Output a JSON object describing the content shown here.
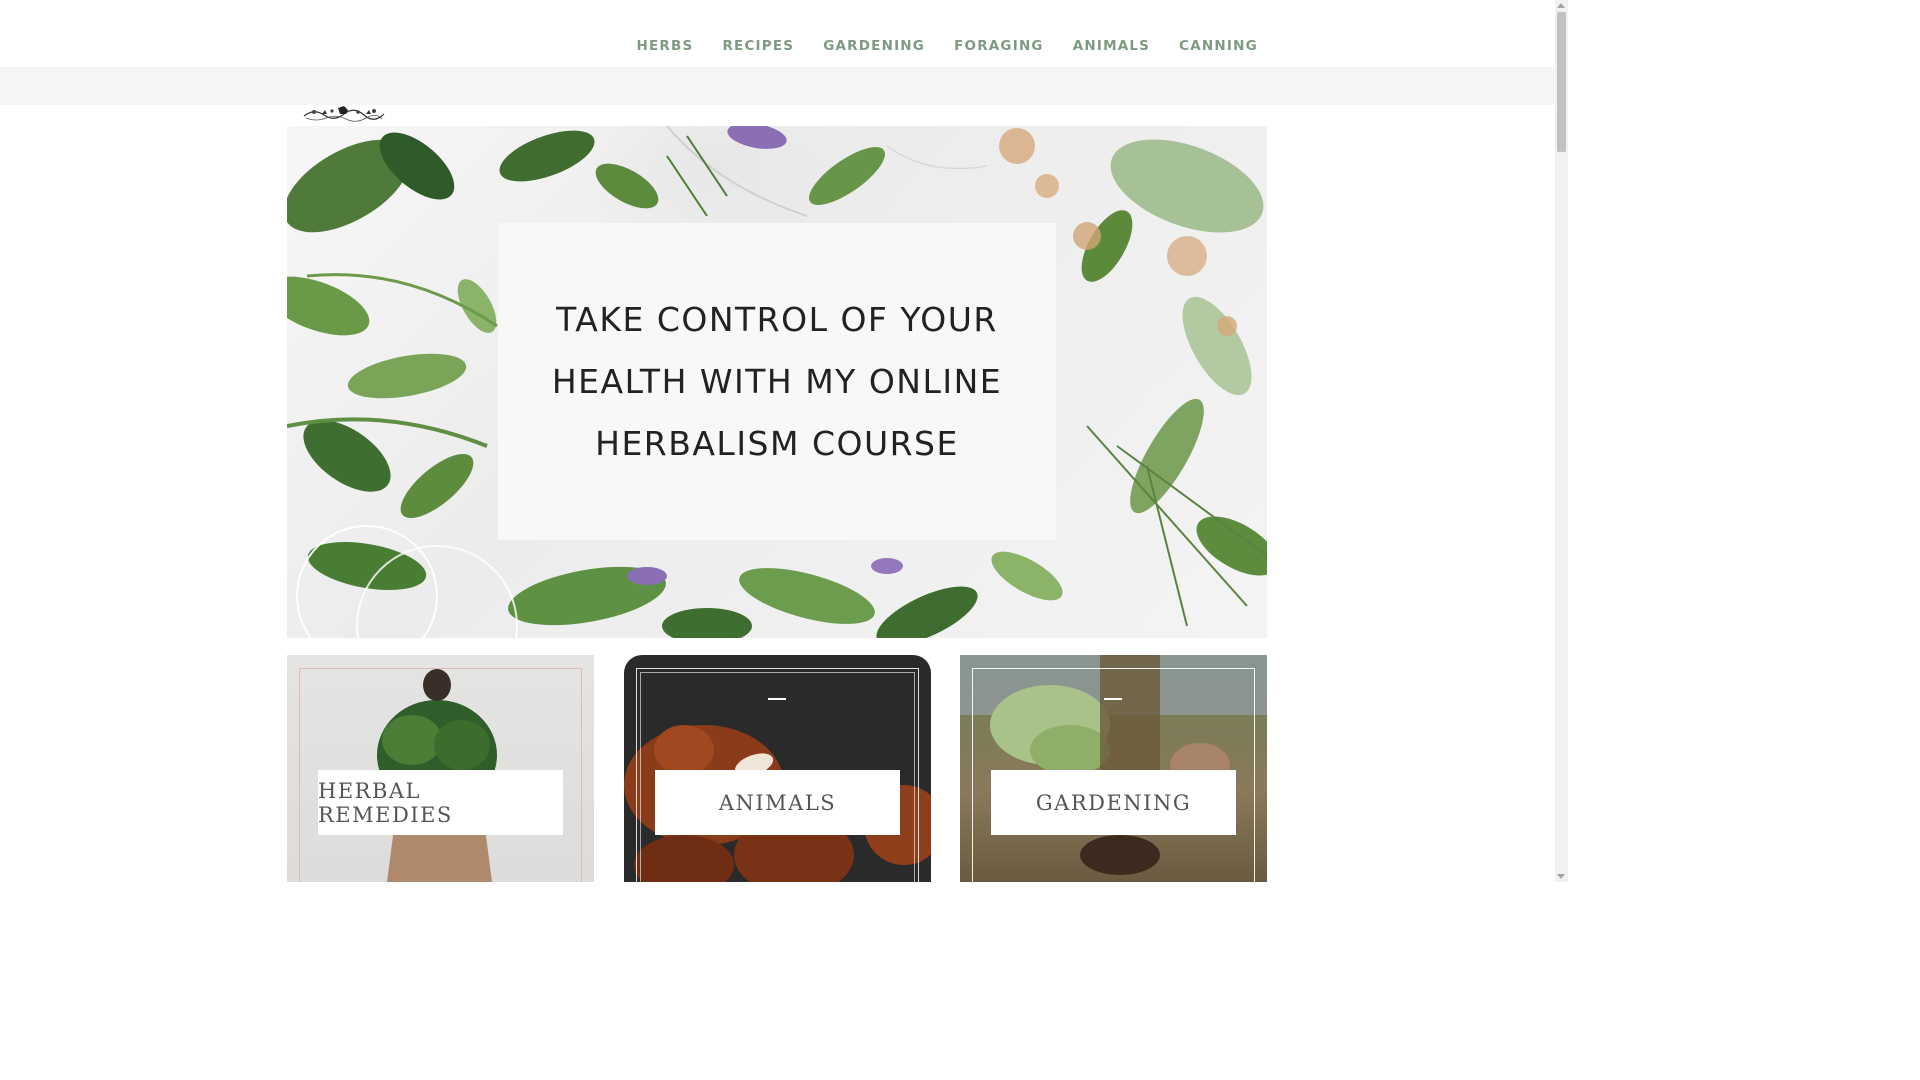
{
  "nav": {
    "items": [
      {
        "label": "HERBS"
      },
      {
        "label": "RECIPES"
      },
      {
        "label": "GARDENING"
      },
      {
        "label": "FORAGING"
      },
      {
        "label": "ANIMALS"
      },
      {
        "label": "CANNING"
      }
    ],
    "color": "#7f9a83"
  },
  "hero": {
    "title": "TAKE CONTROL OF YOUR HEALTH WITH MY ONLINE HERBALISM COURSE"
  },
  "cards": [
    {
      "label": "HERBAL REMEDIES"
    },
    {
      "label": "ANIMALS"
    },
    {
      "label": "GARDENING"
    }
  ],
  "icons": {
    "logo": "floral-logo-icon"
  }
}
